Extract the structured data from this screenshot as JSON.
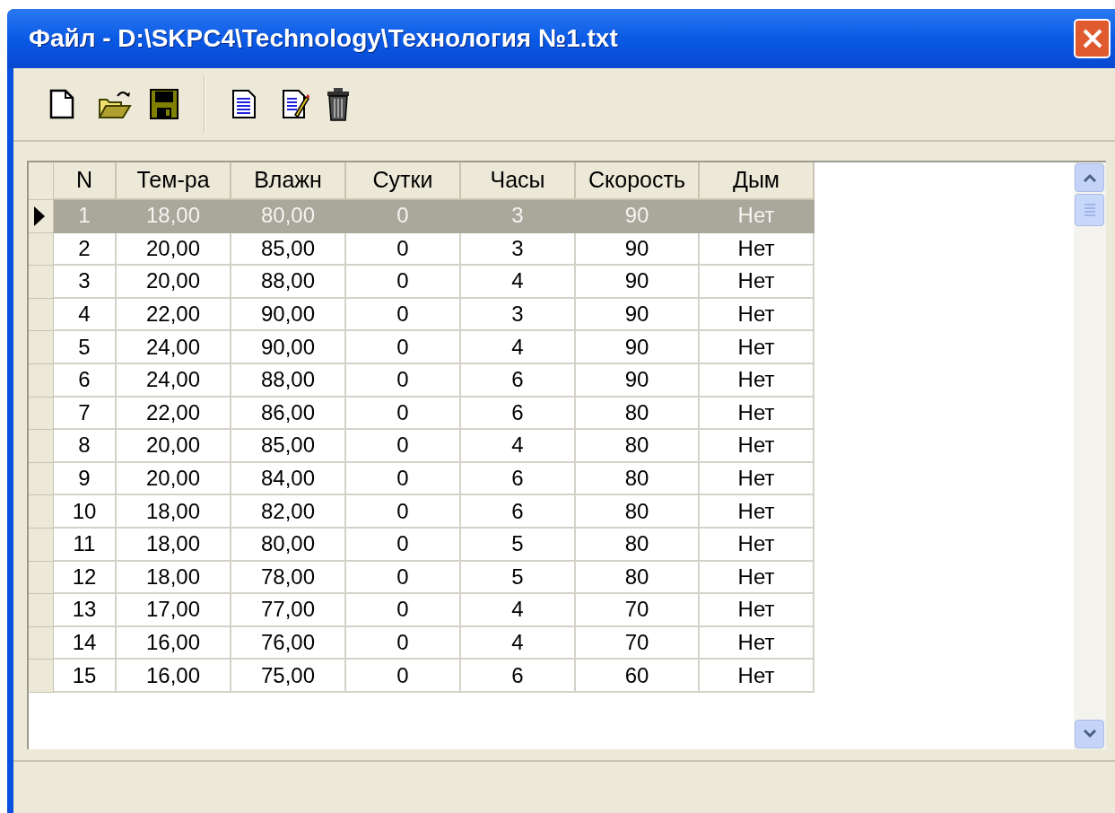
{
  "window": {
    "title": "Файл - D:\\SKPC4\\Technology\\Технология №1.txt"
  },
  "table": {
    "columns": [
      "N",
      "Тем-ра",
      "Влажн",
      "Сутки",
      "Часы",
      "Скорость",
      "Дым"
    ],
    "rows": [
      {
        "cells": [
          "1",
          "18,00",
          "80,00",
          "0",
          "3",
          "90",
          "Нет"
        ],
        "selected": true
      },
      {
        "cells": [
          "2",
          "20,00",
          "85,00",
          "0",
          "3",
          "90",
          "Нет"
        ],
        "selected": false
      },
      {
        "cells": [
          "3",
          "20,00",
          "88,00",
          "0",
          "4",
          "90",
          "Нет"
        ],
        "selected": false
      },
      {
        "cells": [
          "4",
          "22,00",
          "90,00",
          "0",
          "3",
          "90",
          "Нет"
        ],
        "selected": false
      },
      {
        "cells": [
          "5",
          "24,00",
          "90,00",
          "0",
          "4",
          "90",
          "Нет"
        ],
        "selected": false
      },
      {
        "cells": [
          "6",
          "24,00",
          "88,00",
          "0",
          "6",
          "90",
          "Нет"
        ],
        "selected": false
      },
      {
        "cells": [
          "7",
          "22,00",
          "86,00",
          "0",
          "6",
          "80",
          "Нет"
        ],
        "selected": false
      },
      {
        "cells": [
          "8",
          "20,00",
          "85,00",
          "0",
          "4",
          "80",
          "Нет"
        ],
        "selected": false
      },
      {
        "cells": [
          "9",
          "20,00",
          "84,00",
          "0",
          "6",
          "80",
          "Нет"
        ],
        "selected": false
      },
      {
        "cells": [
          "10",
          "18,00",
          "82,00",
          "0",
          "6",
          "80",
          "Нет"
        ],
        "selected": false
      },
      {
        "cells": [
          "11",
          "18,00",
          "80,00",
          "0",
          "5",
          "80",
          "Нет"
        ],
        "selected": false
      },
      {
        "cells": [
          "12",
          "18,00",
          "78,00",
          "0",
          "5",
          "80",
          "Нет"
        ],
        "selected": false
      },
      {
        "cells": [
          "13",
          "17,00",
          "77,00",
          "0",
          "4",
          "70",
          "Нет"
        ],
        "selected": false
      },
      {
        "cells": [
          "14",
          "16,00",
          "76,00",
          "0",
          "4",
          "70",
          "Нет"
        ],
        "selected": false
      },
      {
        "cells": [
          "15",
          "16,00",
          "75,00",
          "0",
          "6",
          "60",
          "Нет"
        ],
        "selected": false
      }
    ]
  }
}
